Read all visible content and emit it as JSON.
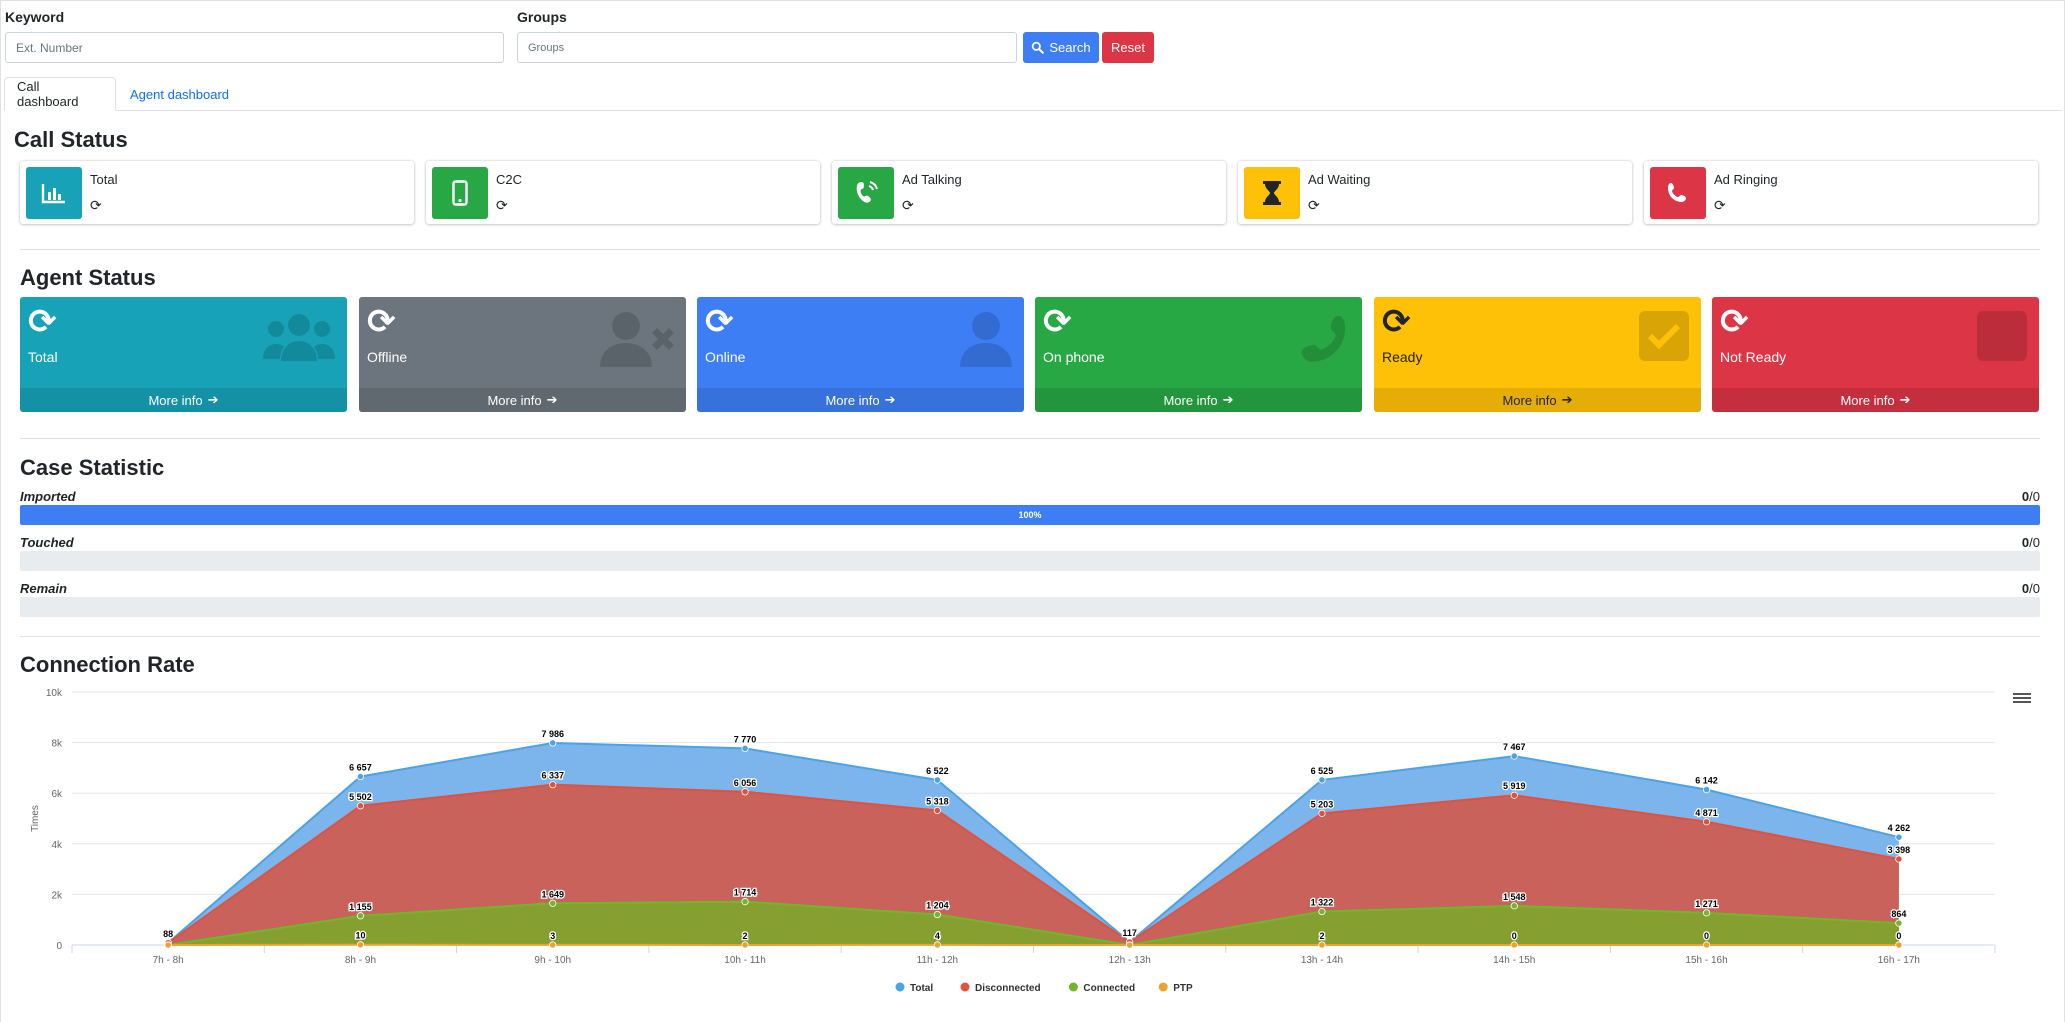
{
  "search": {
    "keyword_label": "Keyword",
    "keyword_placeholder": "Ext. Number",
    "groups_label": "Groups",
    "groups_placeholder": "Groups",
    "search_button": "Search",
    "reset_button": "Reset"
  },
  "tabs": [
    {
      "label": "Call dashboard",
      "active": true
    },
    {
      "label": "Agent dashboard",
      "active": false
    }
  ],
  "call_status": {
    "title": "Call Status",
    "cards": [
      {
        "label": "Total",
        "icon": "bar-chart-icon",
        "color": "#17a2b8"
      },
      {
        "label": "C2C",
        "icon": "mobile-phone-icon",
        "color": "#28a745"
      },
      {
        "label": "Ad Talking",
        "icon": "phone-volume-icon",
        "color": "#28a745"
      },
      {
        "label": "Ad Waiting",
        "icon": "hourglass-icon",
        "color": "#ffc107"
      },
      {
        "label": "Ad Ringing",
        "icon": "phone-icon",
        "color": "#dc3545"
      }
    ]
  },
  "agent_status": {
    "title": "Agent Status",
    "more_info": "More info",
    "cards": [
      {
        "label": "Total",
        "icon": "users-icon",
        "color": "#17a2b8"
      },
      {
        "label": "Offline",
        "icon": "user-times-icon",
        "color": "#6c757d"
      },
      {
        "label": "Online",
        "icon": "user-icon",
        "color": "#3d7ef5"
      },
      {
        "label": "On phone",
        "icon": "phone-icon",
        "color": "#28a745"
      },
      {
        "label": "Ready",
        "icon": "check-square-icon",
        "color": "#ffc107"
      },
      {
        "label": "Not Ready",
        "icon": "square-icon",
        "color": "#dc3545"
      }
    ]
  },
  "case_statistic": {
    "title": "Case Statistic",
    "rows": [
      {
        "label": "Imported",
        "value": "0",
        "total": "/0",
        "percent": 100,
        "bar_text": "100%"
      },
      {
        "label": "Touched",
        "value": "0",
        "total": "/0",
        "percent": 0,
        "bar_text": ""
      },
      {
        "label": "Remain",
        "value": "0",
        "total": "/0",
        "percent": 0,
        "bar_text": ""
      }
    ]
  },
  "connection_rate": {
    "title": "Connection Rate"
  },
  "chart_data": {
    "type": "area",
    "title": "",
    "xlabel": "",
    "ylabel": "Times",
    "ylim": [
      0,
      10000
    ],
    "yticks": [
      "0",
      "2k",
      "4k",
      "6k",
      "8k",
      "10k"
    ],
    "categories": [
      "7h - 8h",
      "8h - 9h",
      "9h - 10h",
      "10h - 11h",
      "11h - 12h",
      "12h - 13h",
      "13h - 14h",
      "14h - 15h",
      "15h - 16h",
      "16h - 17h"
    ],
    "series": [
      {
        "name": "Total",
        "color": "#7cb5ec",
        "line": "#4aa3e8",
        "values": [
          88,
          6657,
          7986,
          7770,
          6522,
          117,
          6525,
          7467,
          6142,
          4262
        ],
        "labels": [
          "88",
          "6 657",
          "7 986",
          "7 770",
          "6 522",
          "117",
          "6 525",
          "7 467",
          "6 142",
          "4 262"
        ]
      },
      {
        "name": "Disconnected",
        "color": "#c8625a",
        "line": "#e4503b",
        "values": [
          88,
          5502,
          6337,
          6056,
          5318,
          117,
          5203,
          5919,
          4871,
          3398
        ],
        "labels": [
          "",
          "5 502",
          "6 337",
          "6 056",
          "5 318",
          "",
          "5 203",
          "5 919",
          "4 871",
          "3 398"
        ]
      },
      {
        "name": "Connected",
        "color": "#85a030",
        "line": "#70b82a",
        "values": [
          0,
          1155,
          1649,
          1714,
          1204,
          0,
          1322,
          1548,
          1271,
          864
        ],
        "labels": [
          "",
          "1 155",
          "1 649",
          "1 714",
          "1 204",
          "",
          "1 322",
          "1 548",
          "1 271",
          "864"
        ]
      },
      {
        "name": "PTP",
        "color": "#f0a030",
        "line": "#f0a030",
        "values": [
          0,
          10,
          3,
          2,
          4,
          0,
          2,
          0,
          0,
          0
        ],
        "labels": [
          "",
          "10",
          "3",
          "2",
          "4",
          "",
          "2",
          "0",
          "0",
          "0"
        ]
      }
    ],
    "legend": "bottom-center",
    "grid": true
  }
}
